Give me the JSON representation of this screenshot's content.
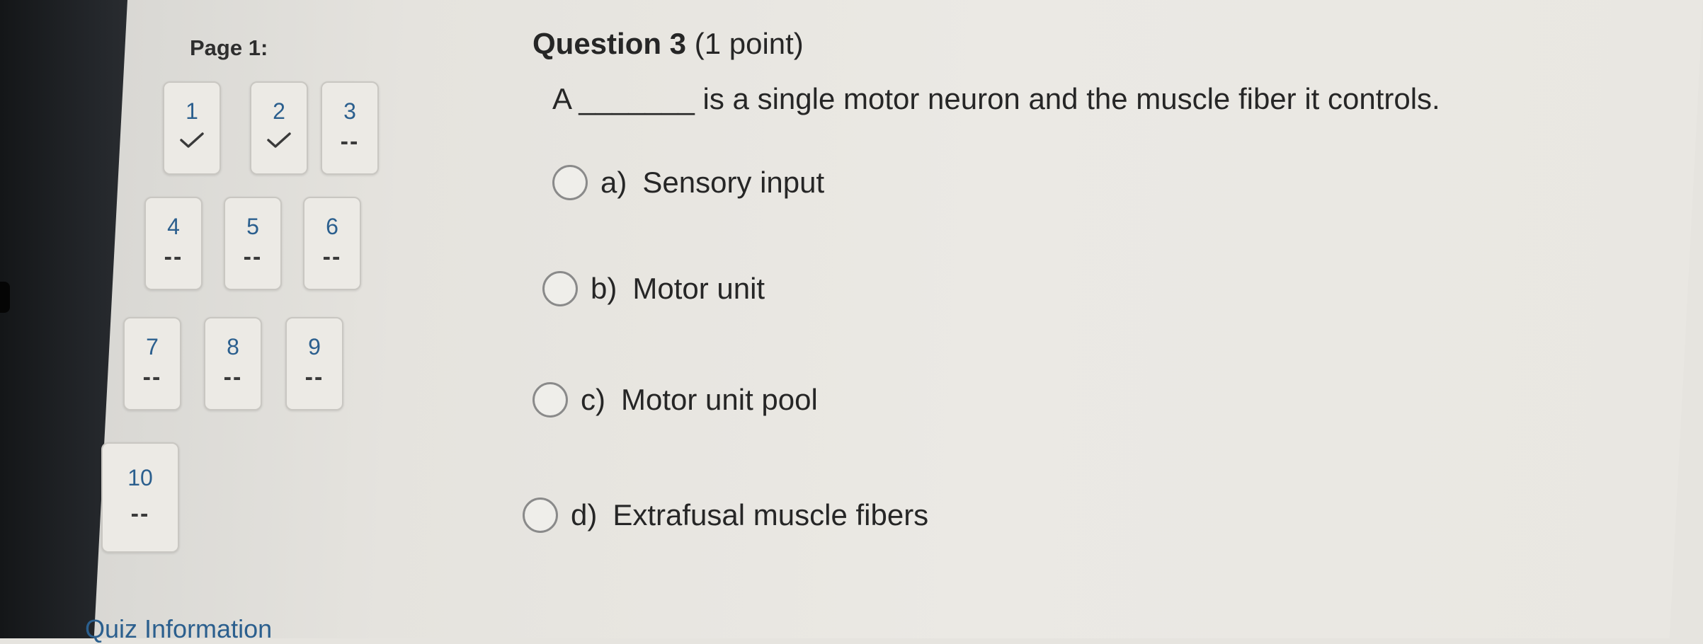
{
  "nav": {
    "page_label": "Page 1:",
    "questions": [
      {
        "num": "1",
        "status": "answered"
      },
      {
        "num": "2",
        "status": "answered"
      },
      {
        "num": "3",
        "status": "--"
      },
      {
        "num": "4",
        "status": "--"
      },
      {
        "num": "5",
        "status": "--"
      },
      {
        "num": "6",
        "status": "--"
      },
      {
        "num": "7",
        "status": "--"
      },
      {
        "num": "8",
        "status": "--"
      },
      {
        "num": "9",
        "status": "--"
      },
      {
        "num": "10",
        "status": "--"
      }
    ],
    "quiz_info_label": "Quiz Information"
  },
  "question": {
    "title": "Question 3",
    "points": "(1 point)",
    "text": "A _______ is a single motor neuron and the muscle fiber it controls.",
    "options": [
      {
        "letter": "a)",
        "label": "Sensory input"
      },
      {
        "letter": "b)",
        "label": "Motor unit"
      },
      {
        "letter": "c)",
        "label": "Motor unit pool"
      },
      {
        "letter": "d)",
        "label": "Extrafusal muscle fibers"
      }
    ]
  },
  "colors": {
    "link": "#2b5f8e",
    "text": "#262626"
  },
  "icons": {
    "answered": "checkmark-icon"
  }
}
